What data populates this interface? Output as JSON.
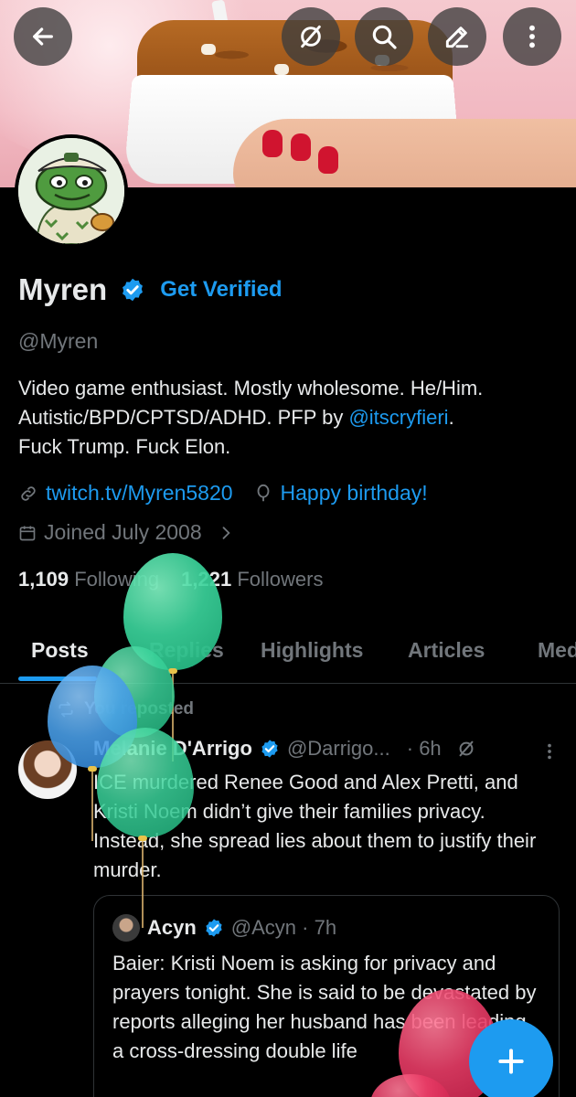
{
  "top_bar": {
    "back_icon": "arrow-left-icon",
    "grok_icon": "grok-icon",
    "search_icon": "search-icon",
    "edit_icon": "edit-pencil-icon",
    "more_icon": "more-vertical-icon"
  },
  "profile": {
    "name": "Myren",
    "get_verified": "Get Verified",
    "handle": "@Myren",
    "bio_line1": "Video game enthusiast. Mostly wholesome. He/Him.",
    "bio_line2_prefix": "Autistic/BPD/CPTSD/ADHD. PFP by ",
    "bio_link": "@itscryfieri",
    "bio_line2_suffix": ".",
    "bio_line3": "Fuck Trump. Fuck Elon.",
    "website": "twitch.tv/Myren5820",
    "birthday": "Happy birthday!",
    "joined": "Joined July 2008",
    "following_count": "1,109",
    "following_label": "Following",
    "followers_count": "1,221",
    "followers_label": "Followers"
  },
  "tabs": [
    {
      "label": "Posts",
      "active": true
    },
    {
      "label": "Replies"
    },
    {
      "label": "Highlights"
    },
    {
      "label": "Articles"
    },
    {
      "label": "Media"
    }
  ],
  "post": {
    "repost_label": "You reposted",
    "author_name": "Melanie D'Arrigo",
    "author_handle": "@Darrigo...",
    "time": "· 6h",
    "text": "ICE murdered Renee Good and Alex Pretti, and Kristi Noem didn’t give their families privacy. Instead, she spread lies  about them to justify their murder.",
    "quote": {
      "author_name": "Acyn",
      "author_handle": "@Acyn · 7h",
      "text": "Baier: Kristi Noem is asking for privacy and prayers tonight. She is said to be devastated by reports alleging her husband has been leading a cross-dressing double life"
    }
  },
  "colors": {
    "accent": "#1d9bf0",
    "muted": "#71767b",
    "text": "#e7e9ea",
    "background": "#000000"
  }
}
